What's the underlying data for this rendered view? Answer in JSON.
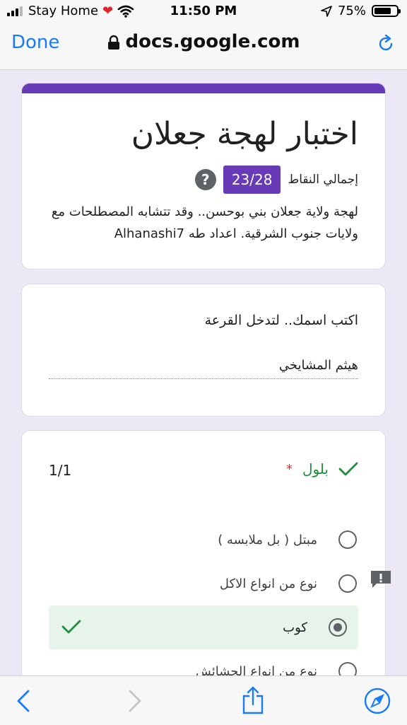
{
  "status_bar": {
    "carrier": "Stay Home",
    "time": "11:50 PM",
    "battery": "75%",
    "battery_level": 0.75
  },
  "browser": {
    "done_label": "Done",
    "url": "docs.google.com"
  },
  "form": {
    "title": "اختبار لهجة جعلان",
    "score_label": "إجمالي النقاط",
    "score": "23/28",
    "help": "?",
    "description": "لهجة ولاية جعلان بني بوحسن.. وقد تتشابه المصطلحات مع ولايات جنوب الشرقية. اعداد طه Alhanashi7"
  },
  "name_question": {
    "label": "اكتب اسمك.. لتدخل القرعة",
    "answer": "هيثم المشايخي"
  },
  "question": {
    "title": "بلول",
    "required_mark": "*",
    "points": "1/1",
    "options": [
      {
        "label": "مبتل ( بل ملابسه )",
        "selected": false
      },
      {
        "label": "نوع من انواع الاكل",
        "selected": false
      },
      {
        "label": "كوب",
        "selected": true
      },
      {
        "label": "نوع من انواع الحشائش",
        "selected": false
      }
    ]
  },
  "colors": {
    "accent": "#673ab7",
    "correct": "#1e8e3e",
    "correct_bg": "#e6f4ea",
    "ios_blue": "#1a7cf4"
  }
}
